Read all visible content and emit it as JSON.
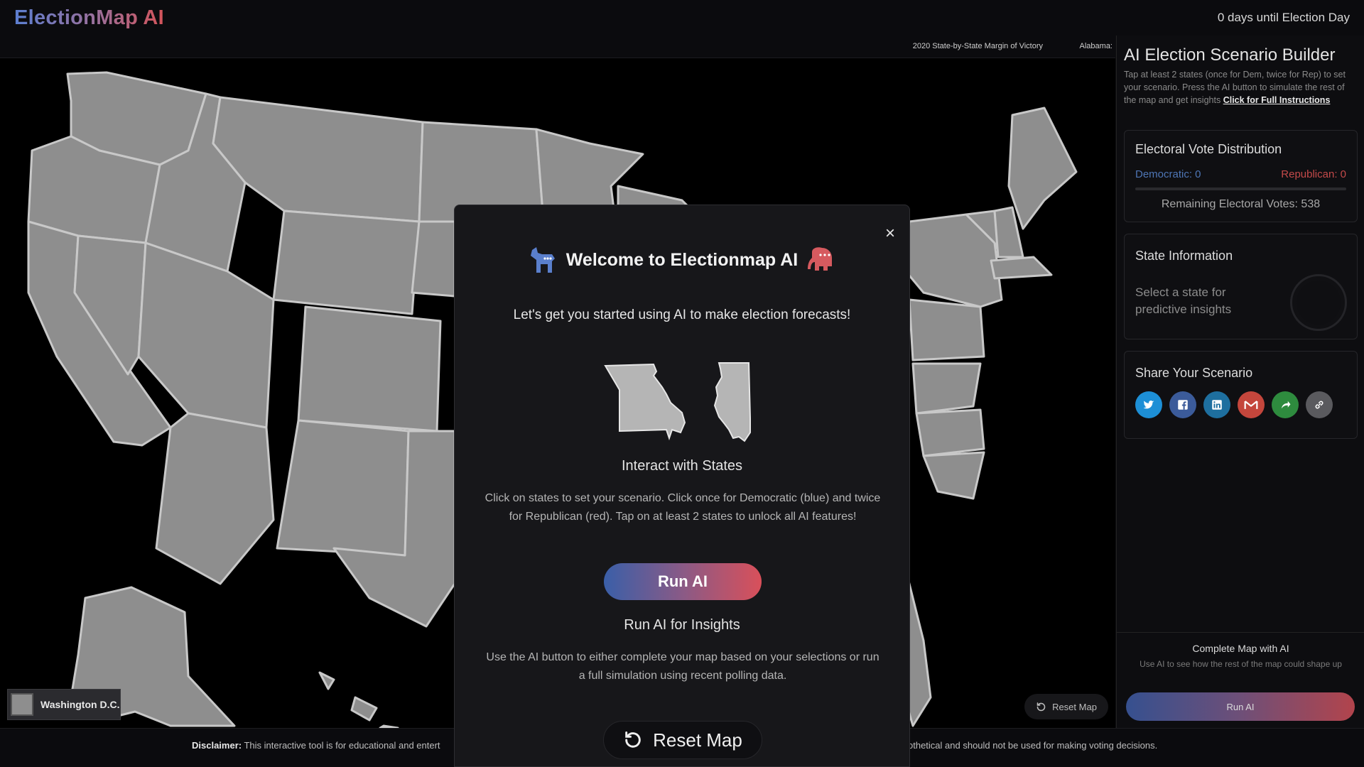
{
  "header": {
    "logo": "ElectionMap AI",
    "countdown": "0 days until Election Day"
  },
  "map": {
    "title": "2020 State-by-State Margin of Victory",
    "hover_state": "Alabama:",
    "dc_label": "Washington D.C.",
    "reset_label": "Reset Map"
  },
  "sidebar": {
    "title": "AI Election Scenario Builder",
    "instructions": "Tap at least 2 states (once for Dem, twice for Rep) to set your scenario. Press the AI button to simulate the rest of the map and get insights",
    "instructions_link": "Click for Full Instructions",
    "electoral": {
      "title": "Electoral Vote Distribution",
      "democratic": "Democratic: 0",
      "republican": "Republican: 0",
      "remaining": "Remaining Electoral Votes: 538"
    },
    "state_info": {
      "title": "State Information",
      "placeholder": "Select a state for predictive insights"
    },
    "share": {
      "title": "Share Your Scenario",
      "icons": [
        "twitter-icon",
        "facebook-icon",
        "linkedin-icon",
        "gmail-icon",
        "share-icon",
        "link-icon"
      ]
    },
    "complete": {
      "title": "Complete Map with AI",
      "description": "Use AI to see how the rest of the map could shape up",
      "button": "Run AI"
    }
  },
  "footer": {
    "disclaimer_label": "Disclaimer:",
    "disclaimer_left": "This interactive tool is for educational and entert",
    "disclaimer_right": "othetical and should not be used for making voting decisions."
  },
  "modal": {
    "close": "×",
    "title": "Welcome to Electionmap AI",
    "subtitle": "Let's get you started using AI to make election forecasts!",
    "interact_title": "Interact with States",
    "interact_text": "Click on states to set your scenario. Click once for Democratic (blue) and twice for Republican (red). Tap on at least 2 states to unlock all AI features!",
    "run_button": "Run AI",
    "run_title": "Run AI for Insights",
    "run_text": "Use the AI button to either complete your map based on your selections or run a full simulation using recent polling data.",
    "reset_button": "Reset Map"
  },
  "colors": {
    "democratic": "#4e76b6",
    "republican": "#c44a4a",
    "state_fill": "#8e8e8e",
    "state_stroke": "#c8c8c8",
    "twitter": "#1d8fd6",
    "facebook": "#3b5b9a",
    "linkedin": "#1e6f9f",
    "gmail": "#c4463c",
    "share": "#2e8b3e",
    "link": "#5a5a5e"
  }
}
